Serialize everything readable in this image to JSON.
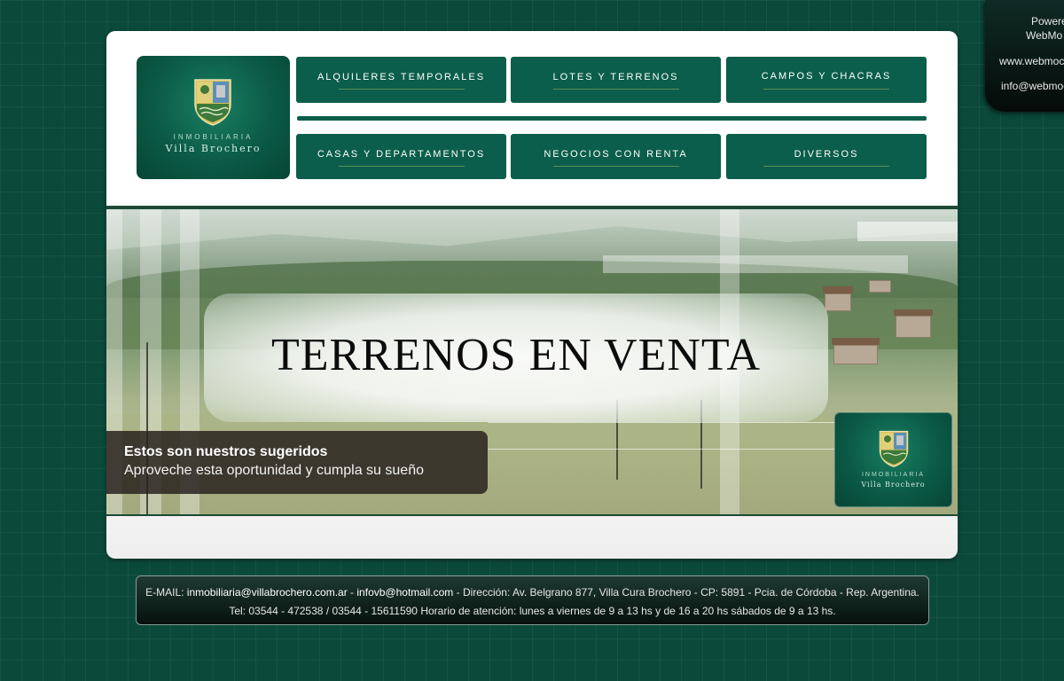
{
  "powered": {
    "line1": "Powere",
    "line2": "WebMo",
    "line3": "www.webmoc",
    "line4": "info@webmoc"
  },
  "logo": {
    "inmobiliaria": "INMOBILIARIA",
    "name": "Villa Brochero"
  },
  "nav": {
    "row1": [
      "ALQUILERES TEMPORALES",
      "LOTES Y TERRENOS",
      "CAMPOS Y CHACRAS"
    ],
    "row2": [
      "CASAS Y DEPARTAMENTOS",
      "NEGOCIOS CON RENTA",
      "DIVERSOS"
    ]
  },
  "banner": {
    "headline": "TERRENOS EN VENTA",
    "suggest_title": "Estos son nuestros sugeridos",
    "suggest_text": "Aproveche esta oportunidad y cumpla su sueño"
  },
  "footer": {
    "email_label": "E-MAIL: ",
    "email1": "inmobiliaria@villabrochero.com.ar",
    "sep": " - ",
    "email2": "infovb@hotmail.com",
    "address": " - Dirección: Av. Belgrano 877, Villa Cura Brochero - CP: 5891 - Pcia. de Córdoba - Rep. Argentina.",
    "line2": "Tel: 03544 - 472538 / 03544 - 15611590 Horario de atención: lunes a viernes de 9 a 13 hs y de 16 a 20 hs sábados de 9 a 13 hs."
  },
  "colors": {
    "background": "#0b4a3b",
    "nav_button": "#0b5e4b",
    "footer": "#06100d"
  }
}
